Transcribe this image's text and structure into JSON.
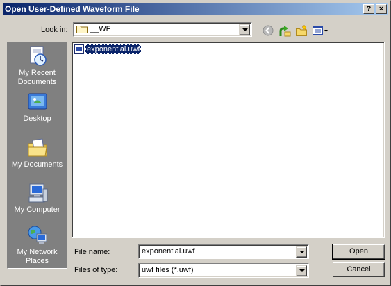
{
  "window": {
    "title": "Open User-Defined Waveform File",
    "help_label": "?",
    "close_label": "×"
  },
  "lookin": {
    "label": "Look in:",
    "value": "__WF"
  },
  "toolbar": {
    "icons": [
      "back-icon",
      "up-folder-icon",
      "new-folder-icon",
      "view-menu-icon"
    ]
  },
  "places": [
    {
      "label": "My Recent Documents",
      "icon": "recent-documents-icon"
    },
    {
      "label": "Desktop",
      "icon": "desktop-icon"
    },
    {
      "label": "My Documents",
      "icon": "my-documents-icon"
    },
    {
      "label": "My Computer",
      "icon": "my-computer-icon"
    },
    {
      "label": "My Network Places",
      "icon": "network-places-icon"
    }
  ],
  "files": [
    {
      "name": "exponential.uwf",
      "selected": true
    }
  ],
  "filename": {
    "label": "File name:",
    "value": "exponential.uwf"
  },
  "filetype": {
    "label": "Files of type:",
    "value": "uwf files (*.uwf)"
  },
  "buttons": {
    "open": "Open",
    "cancel": "Cancel"
  }
}
